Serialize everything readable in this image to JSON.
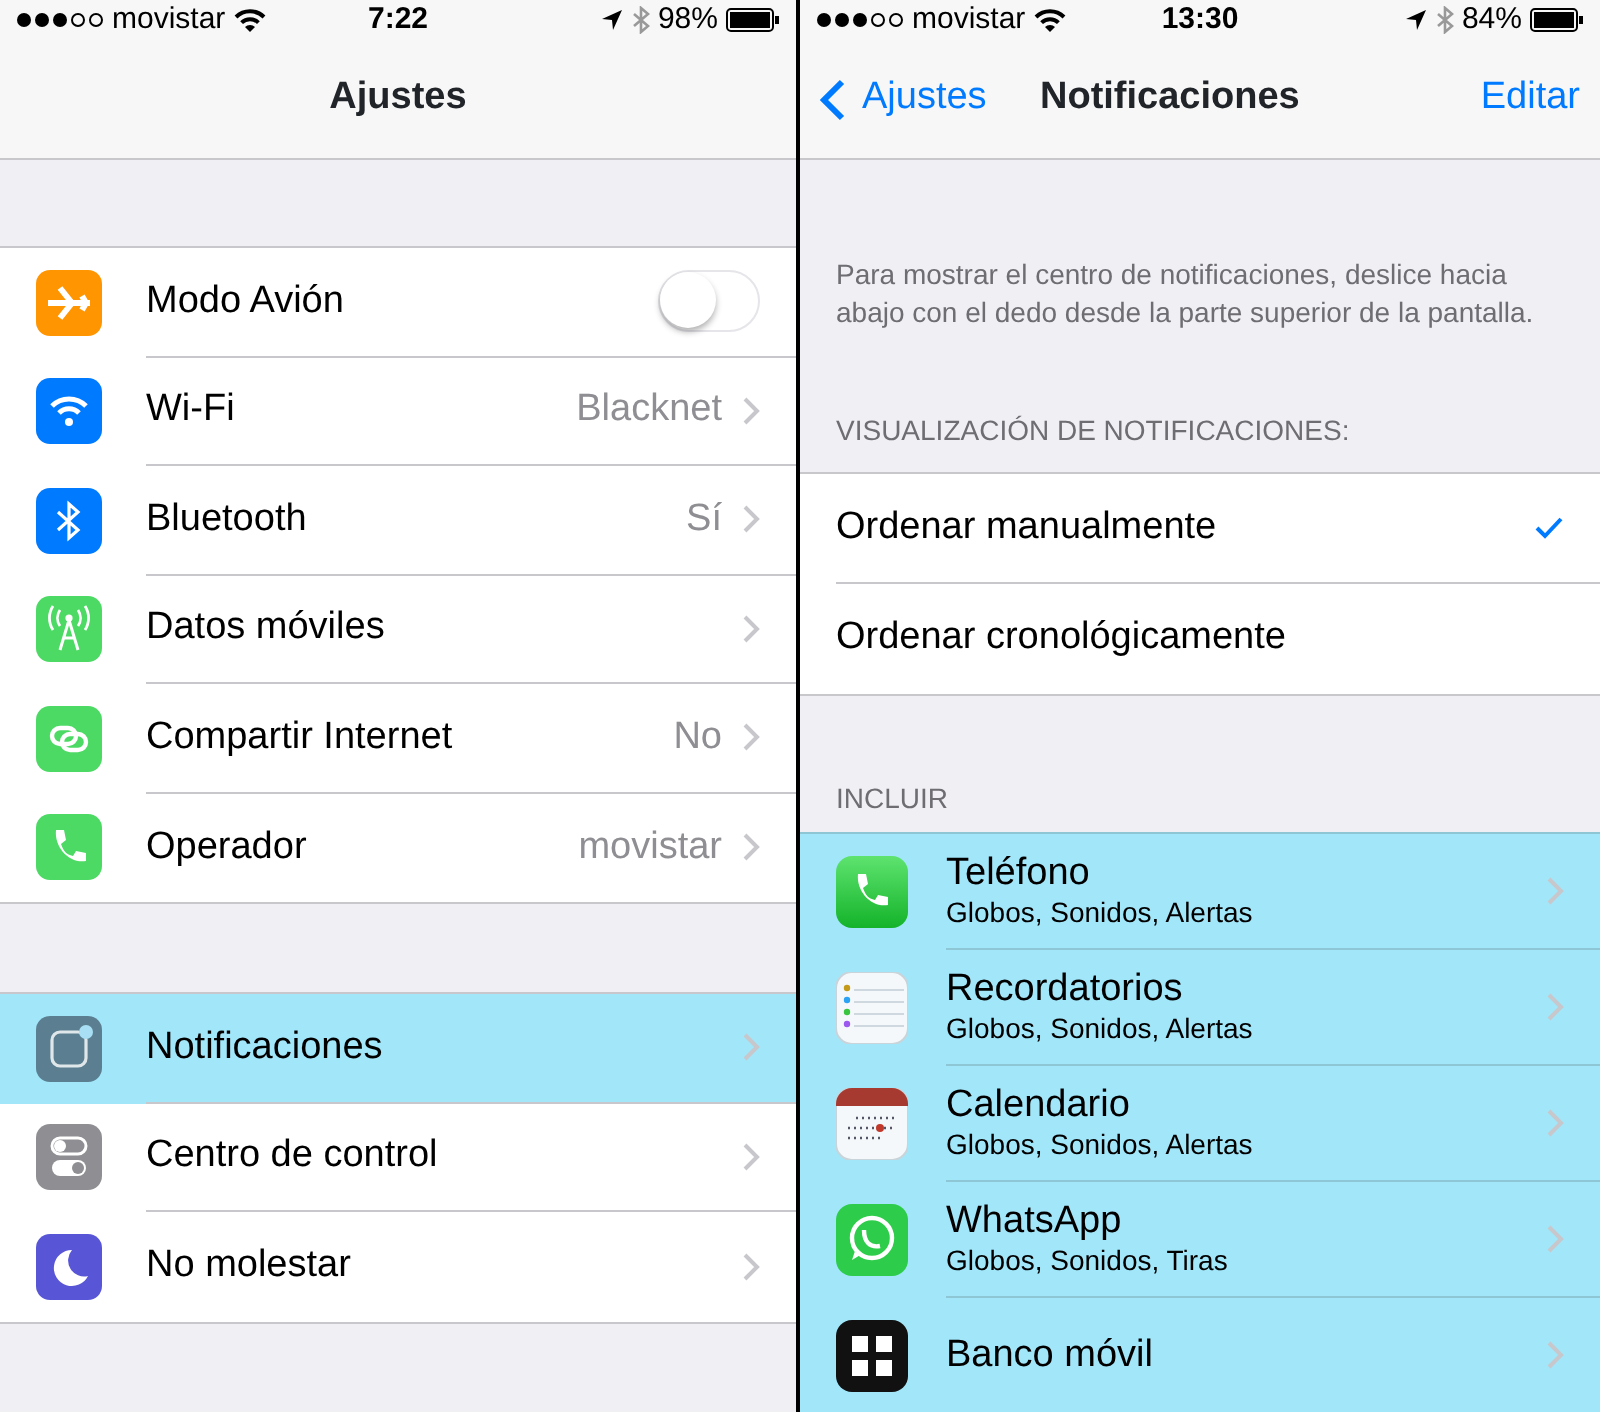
{
  "left_screen": {
    "status_bar": {
      "carrier": "movistar",
      "time": "7:22",
      "battery": "98%"
    },
    "nav": {
      "title": "Ajustes"
    },
    "groups": [
      {
        "rows": [
          {
            "kind": "toggle",
            "label": "Modo Avión",
            "on": false,
            "highlighted": false
          },
          {
            "kind": "link",
            "label": "Wi-Fi",
            "value": "Blacknet",
            "highlighted": false
          },
          {
            "kind": "link",
            "label": "Bluetooth",
            "value": "Sí",
            "highlighted": false
          },
          {
            "kind": "link",
            "label": "Datos móviles",
            "highlighted": false
          },
          {
            "kind": "link",
            "label": "Compartir Internet",
            "value": "No",
            "highlighted": false
          },
          {
            "kind": "link",
            "label": "Operador",
            "value": "movistar",
            "highlighted": false
          }
        ]
      },
      {
        "rows": [
          {
            "kind": "link",
            "label": "Notificaciones",
            "highlighted": true
          },
          {
            "kind": "link",
            "label": "Centro de control",
            "highlighted": false
          },
          {
            "kind": "link",
            "label": "No molestar",
            "highlighted": false
          }
        ]
      }
    ]
  },
  "right_screen": {
    "status_bar": {
      "carrier": "movistar",
      "time": "13:30",
      "battery": "84%"
    },
    "nav": {
      "back": "Ajustes",
      "title": "Notificaciones",
      "action": "Editar"
    },
    "description": "Para mostrar el centro de notificaciones, deslice hacia abajo con el dedo desde la parte superior de la pantalla.",
    "sort_header": "VISUALIZACIÓN DE NOTIFICACIONES:",
    "sort_options": [
      {
        "label": "Ordenar manualmente",
        "selected": true
      },
      {
        "label": "Ordenar cronológicamente",
        "selected": false
      }
    ],
    "include_header": "INCLUIR",
    "apps": [
      {
        "name": "Teléfono",
        "detail": "Globos, Sonidos, Alertas",
        "highlighted": true
      },
      {
        "name": "Recordatorios",
        "detail": "Globos, Sonidos, Alertas",
        "highlighted": true
      },
      {
        "name": "Calendario",
        "detail": "Globos, Sonidos, Alertas",
        "highlighted": true
      },
      {
        "name": "WhatsApp",
        "detail": "Globos, Sonidos, Tiras",
        "highlighted": true
      },
      {
        "name": "Banco móvil",
        "highlighted": true
      }
    ]
  }
}
